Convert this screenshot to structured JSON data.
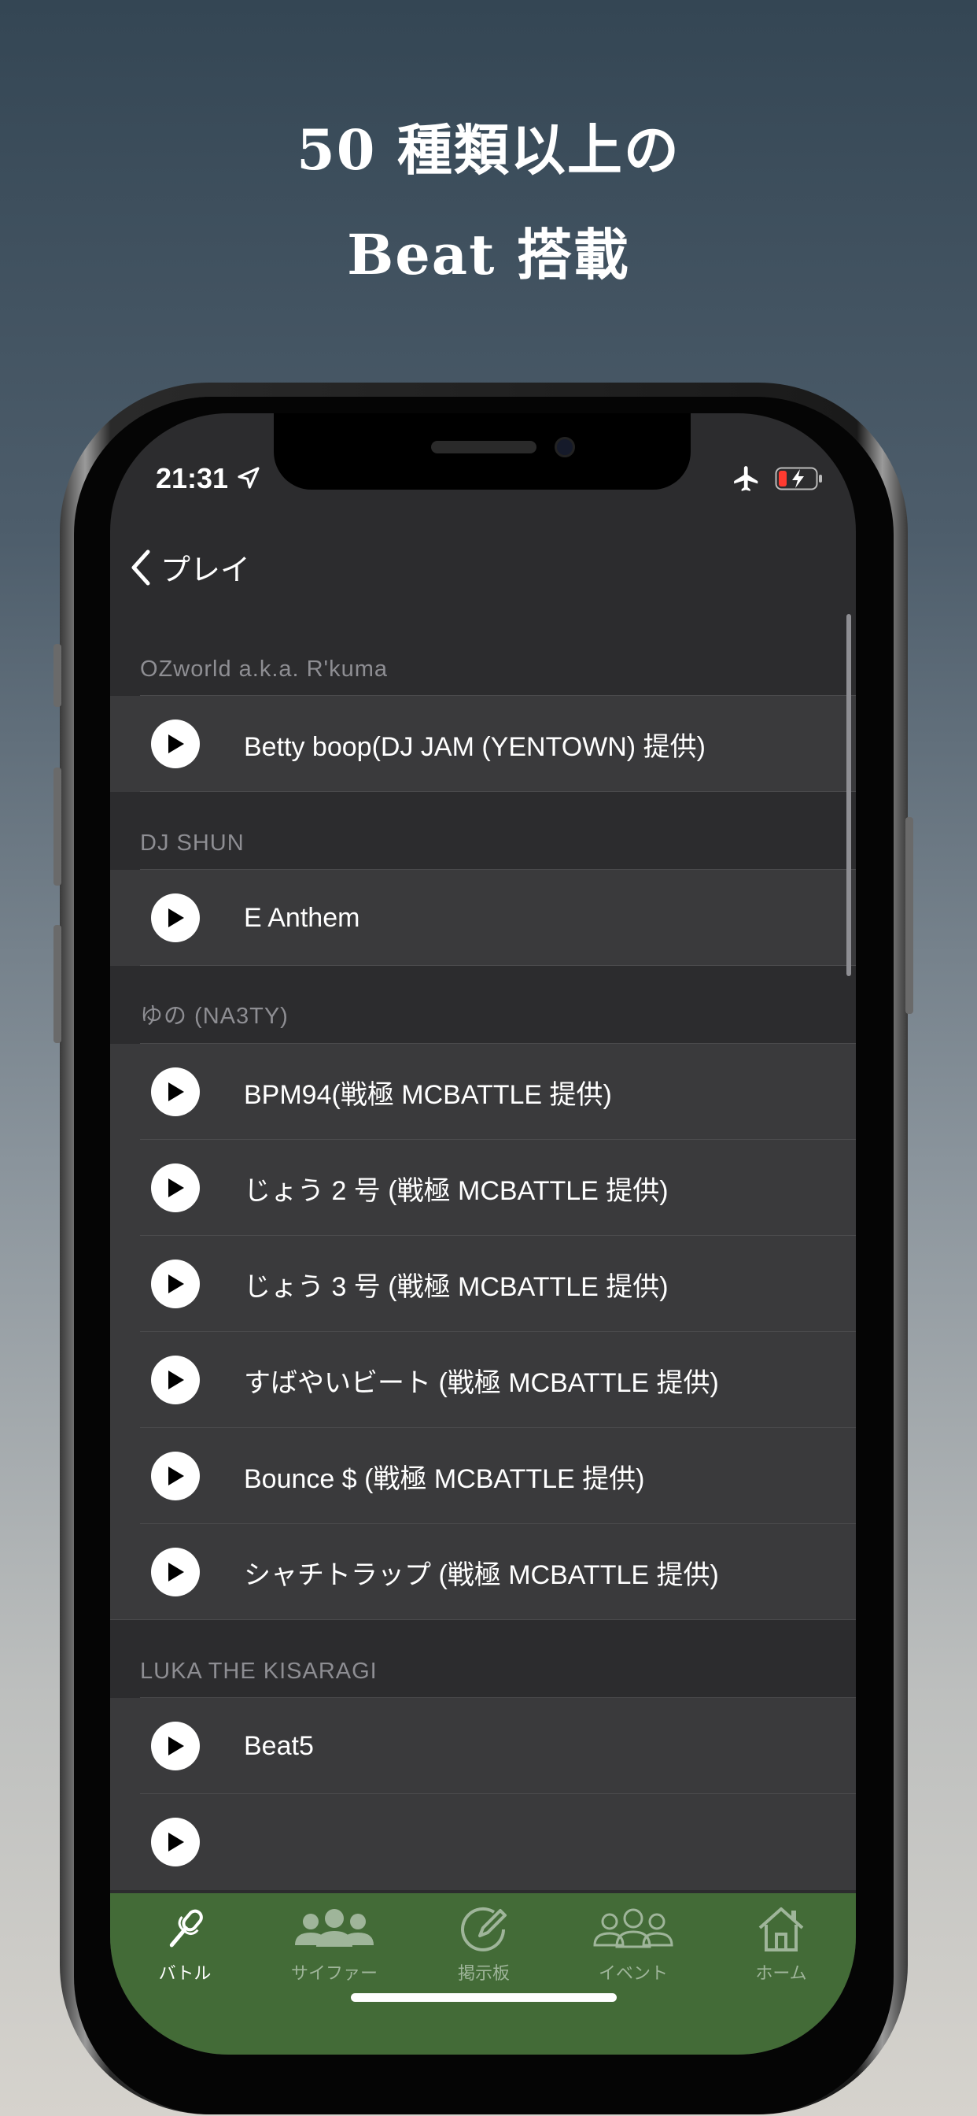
{
  "promo": {
    "line1": "50 種類以上の",
    "line2": "Beat 搭載"
  },
  "status_bar": {
    "time": "21:31",
    "icons": [
      "location-arrow-icon",
      "airplane-icon",
      "battery-charging-icon"
    ]
  },
  "nav": {
    "back_label": "プレイ",
    "back_icon": "chevron-left-icon"
  },
  "sections": [
    {
      "header": "OZworld a.k.a. R'kuma",
      "items": [
        "Betty boop(DJ JAM (YENTOWN) 提供)"
      ]
    },
    {
      "header": "DJ SHUN",
      "items": [
        "E Anthem"
      ]
    },
    {
      "header": "ゆの (NA3TY)",
      "items": [
        "BPM94(戦極 MCBATTLE 提供)",
        "じょう 2 号 (戦極 MCBATTLE 提供)",
        "じょう 3 号 (戦極 MCBATTLE 提供)",
        "すばやいビート (戦極 MCBATTLE 提供)",
        "Bounce $ (戦極 MCBATTLE 提供)",
        "シャチトラップ (戦極 MCBATTLE 提供)"
      ]
    },
    {
      "header": "LUKA THE KISARAGI",
      "items": [
        "Beat5"
      ]
    }
  ],
  "tabbar": {
    "tabs": [
      {
        "label": "バトル",
        "icon": "microphone-icon",
        "active": true
      },
      {
        "label": "サイファー",
        "icon": "group-icon",
        "active": false
      },
      {
        "label": "掲示板",
        "icon": "compose-icon",
        "active": false
      },
      {
        "label": "イベント",
        "icon": "people-outline-icon",
        "active": false
      },
      {
        "label": "ホーム",
        "icon": "home-icon",
        "active": false
      }
    ]
  },
  "colors": {
    "tabbar_bg": "#436b37",
    "active_tab": "#ffffff",
    "inactive_tab": "#9fb59a",
    "list_bg": "#2c2c2e",
    "row_bg": "#3a3a3c"
  }
}
